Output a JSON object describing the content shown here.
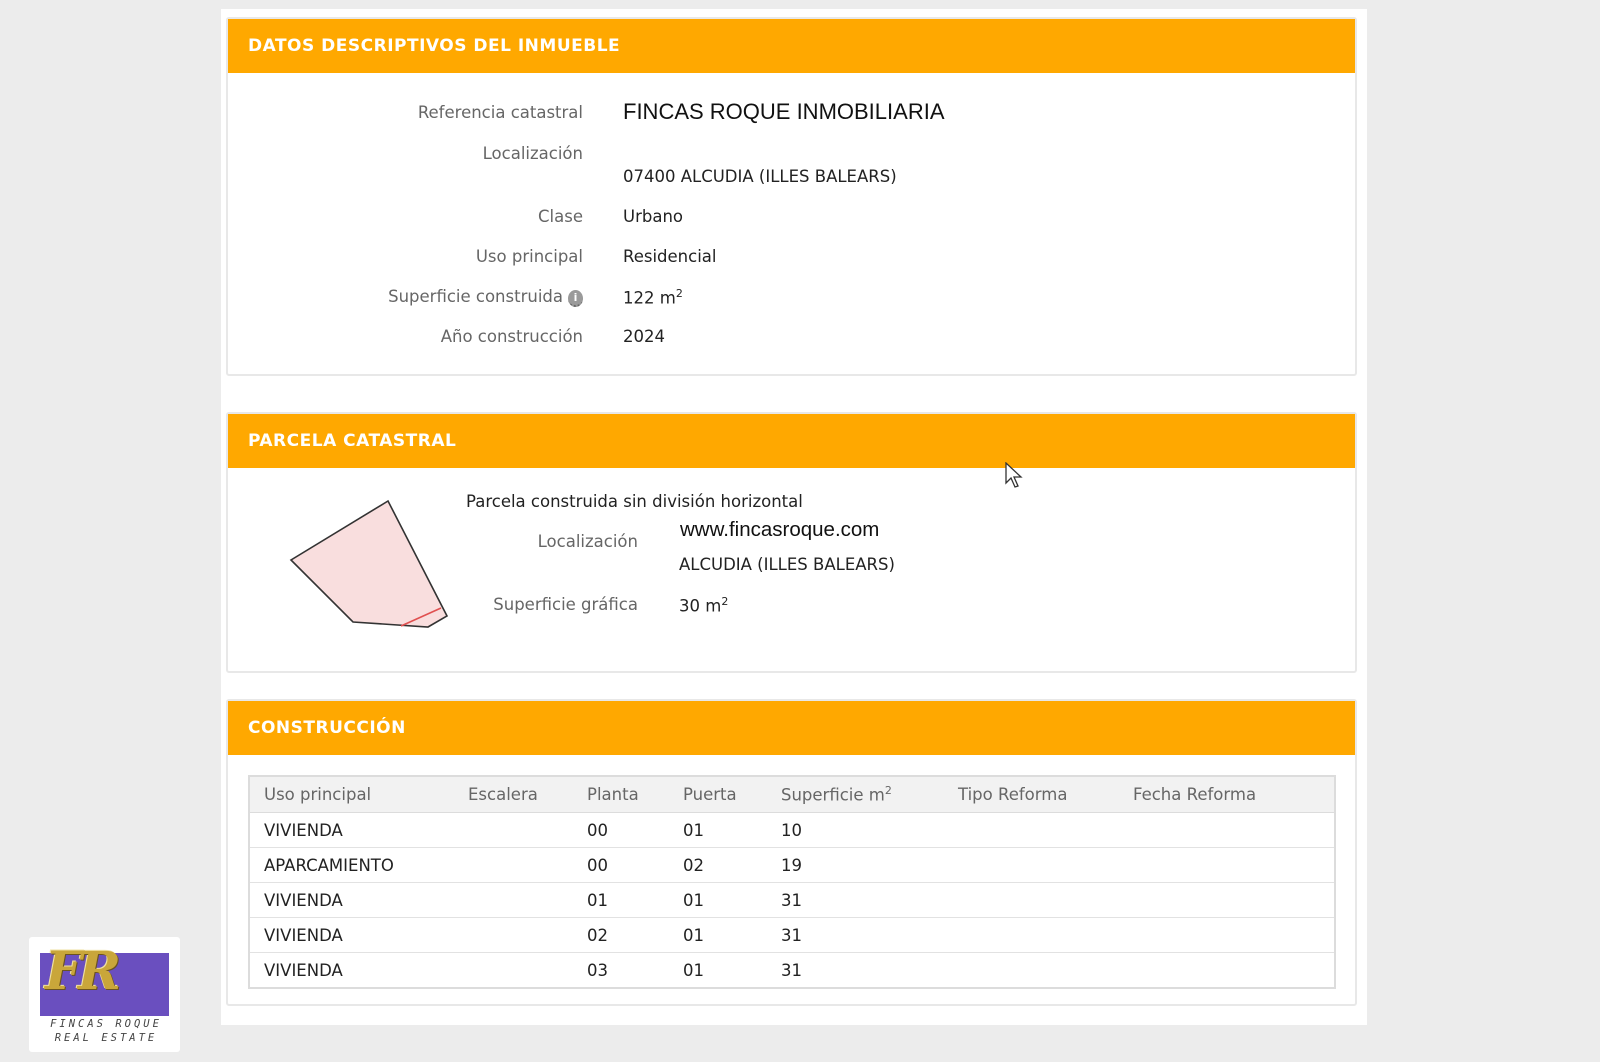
{
  "panels": {
    "datos": {
      "title": "DATOS DESCRIPTIVOS DEL INMUEBLE",
      "fields": [
        {
          "label": "Referencia catastral",
          "value": "FINCAS ROQUE INMOBILIARIA"
        },
        {
          "label": "Localización",
          "value": "07400 ALCUDIA (ILLES BALEARS)"
        },
        {
          "label": "Clase",
          "value": "Urbano"
        },
        {
          "label": "Uso principal",
          "value": "Residencial"
        },
        {
          "label": "Superficie construida",
          "value": "122 m",
          "unit_sup": "2",
          "info_icon": "info-icon"
        },
        {
          "label": "Año construcción",
          "value": "2024"
        }
      ]
    },
    "parcela": {
      "title": "PARCELA CATASTRAL",
      "subtitle": "Parcela construida sin división horizontal",
      "localizacion_label": "Localización",
      "localizacion_line1": "www.fincasroque.com",
      "localizacion_line2": "ALCUDIA (ILLES BALEARS)",
      "superficie_label": "Superficie gráfica",
      "superficie_value": "30 m",
      "superficie_sup": "2"
    },
    "construccion": {
      "title": "CONSTRUCCIÓN",
      "columns": [
        "Uso principal",
        "Escalera",
        "Planta",
        "Puerta",
        "Superficie m",
        "Tipo Reforma",
        "Fecha Reforma"
      ],
      "superficie_sup": "2",
      "rows": [
        [
          "VIVIENDA",
          "",
          "00",
          "01",
          "10",
          "",
          ""
        ],
        [
          "APARCAMIENTO",
          "",
          "00",
          "02",
          "19",
          "",
          ""
        ],
        [
          "VIVIENDA",
          "",
          "01",
          "01",
          "31",
          "",
          ""
        ],
        [
          "VIVIENDA",
          "",
          "02",
          "01",
          "31",
          "",
          ""
        ],
        [
          "VIVIENDA",
          "",
          "03",
          "01",
          "31",
          "",
          ""
        ]
      ]
    }
  },
  "logo": {
    "letters": "FR",
    "line1": "FINCAS ROQUE",
    "line2": "REAL ESTATE"
  },
  "colors": {
    "header": "#ffa800",
    "parcel_fill": "#f9dede",
    "parcel_edge_highlight": "#e05050"
  }
}
